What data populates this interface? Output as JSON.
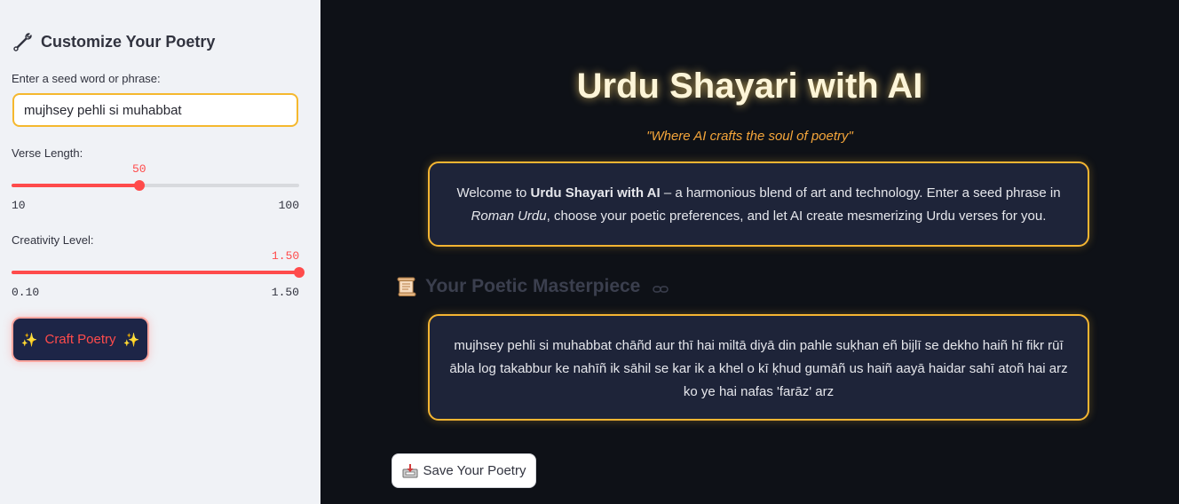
{
  "sidebar": {
    "title": "Customize Your Poetry",
    "seed_label": "Enter a seed word or phrase:",
    "seed_value": "mujhsey pehli si muhabbat",
    "verse_length": {
      "label": "Verse Length:",
      "value": "50",
      "min": "10",
      "max": "100",
      "fraction": 0.444
    },
    "creativity": {
      "label": "Creativity Level:",
      "value": "1.50",
      "min": "0.10",
      "max": "1.50",
      "fraction": 1.0
    },
    "craft_button": {
      "label": "Craft Poetry",
      "sparkle": "✨"
    }
  },
  "main": {
    "title": "Urdu Shayari with AI",
    "subtitle": "\"Where AI crafts the soul of poetry\"",
    "intro": {
      "p1": "Welcome to ",
      "app_name": "Urdu Shayari with AI",
      "p2": " – a harmonious blend of art and technology. Enter a seed phrase in ",
      "roman": "Roman Urdu",
      "p3": ", choose your poetic preferences, and let AI create mesmerizing Urdu verses for you."
    },
    "section_title": "Your Poetic Masterpiece",
    "verse_text": "mujhsey pehli si muhabbat chāñd aur thī hai miltā diyā din pahle suḳhan eñ bijlī se dekho haiñ hī fikr rūī ābla log takabbur ke nahīñ ik sāhil se kar ik a khel o kī ḳhud gumāñ us haiñ aayā haidar sahī atoñ hai arz ko ye hai nafas 'farāz' arz",
    "save_button": "Save Your Poetry"
  },
  "colors": {
    "accent": "#ff4b4b",
    "gold": "#f4b532",
    "background": "#0e1117",
    "card": "#1e2439",
    "sidebar": "#f0f2f6"
  },
  "icons": [
    "wrench-icon",
    "sparkle-icon",
    "scroll-icon",
    "link-icon",
    "inbox-tray-icon"
  ]
}
